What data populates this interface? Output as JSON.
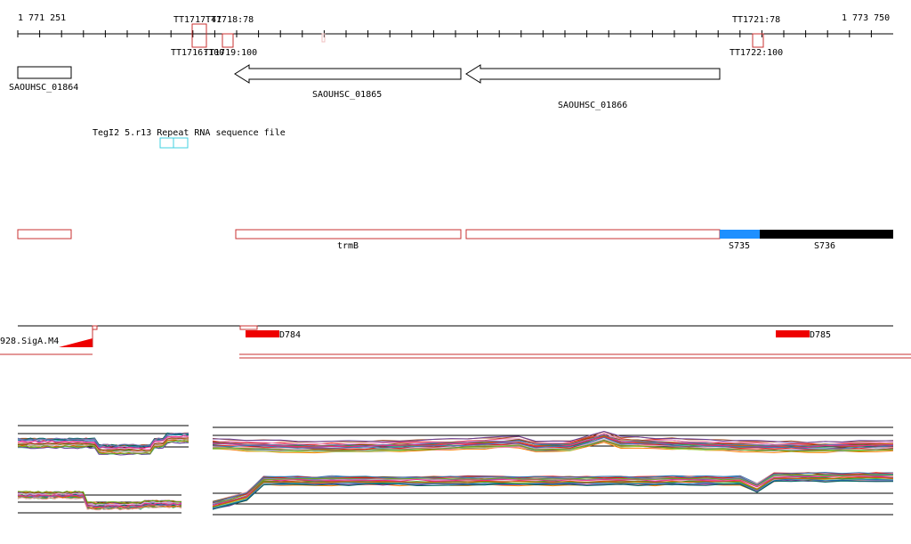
{
  "ruler": {
    "start_label": "1 771 251",
    "end_label": "1 773 750"
  },
  "terminators_top": [
    "TT1717:47",
    "TT1718:78",
    "TT1721:78"
  ],
  "terminators_bottom": [
    "TT1716:100",
    "TT1719:100",
    "TT1722:100"
  ],
  "genes": {
    "g1": "SAOUHSC_01864",
    "g2": "SAOUHSC_01865",
    "g3": "SAOUHSC_01866"
  },
  "misc_labels": {
    "overlap_text": "TegI2 5.r13 Repeat RNA sequence file",
    "trmB": "trmB",
    "s735": "S735",
    "s736": "S736",
    "sigA": "928.SigA.M4",
    "d784": "D784",
    "d785": "D785"
  },
  "colors": {
    "feature_red": "#c83232",
    "promoter_red": "#ee0000",
    "repeat_cyan": "#40d0e0",
    "segment_blue": "#1e90ff",
    "segment_black": "#000000"
  }
}
